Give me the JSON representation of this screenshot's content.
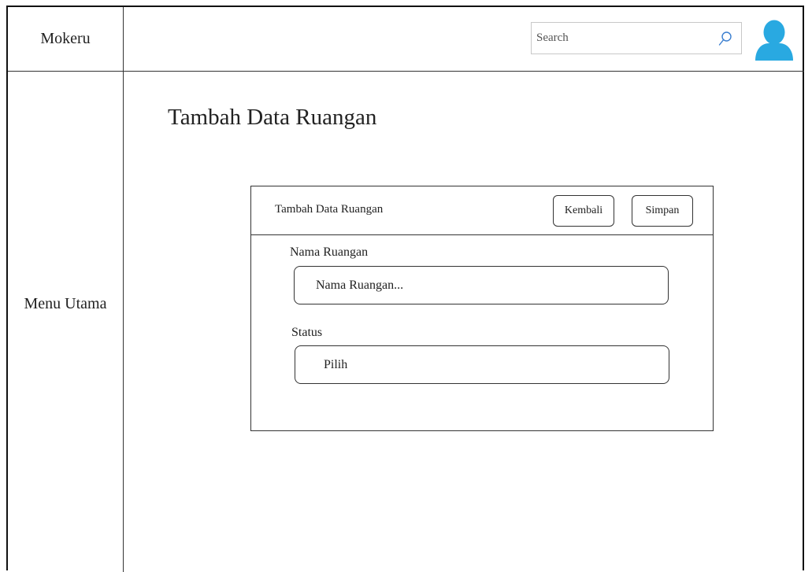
{
  "app": {
    "brand": "Mokeru"
  },
  "sidebar": {
    "menu_label": "Menu Utama"
  },
  "header": {
    "search": {
      "placeholder": "Search",
      "value": ""
    },
    "icons": {
      "search": "search-icon",
      "avatar": "user-avatar-icon"
    },
    "colors": {
      "avatar": "#29a9e1"
    }
  },
  "main": {
    "title": "Tambah Data Ruangan",
    "card": {
      "title": "Tambah Data Ruangan",
      "back_label": "Kembali",
      "save_label": "Simpan",
      "fields": {
        "room_name": {
          "label": "Nama Ruangan",
          "placeholder": "Nama Ruangan..."
        },
        "status": {
          "label": "Status",
          "selected": "Pilih"
        }
      }
    }
  }
}
